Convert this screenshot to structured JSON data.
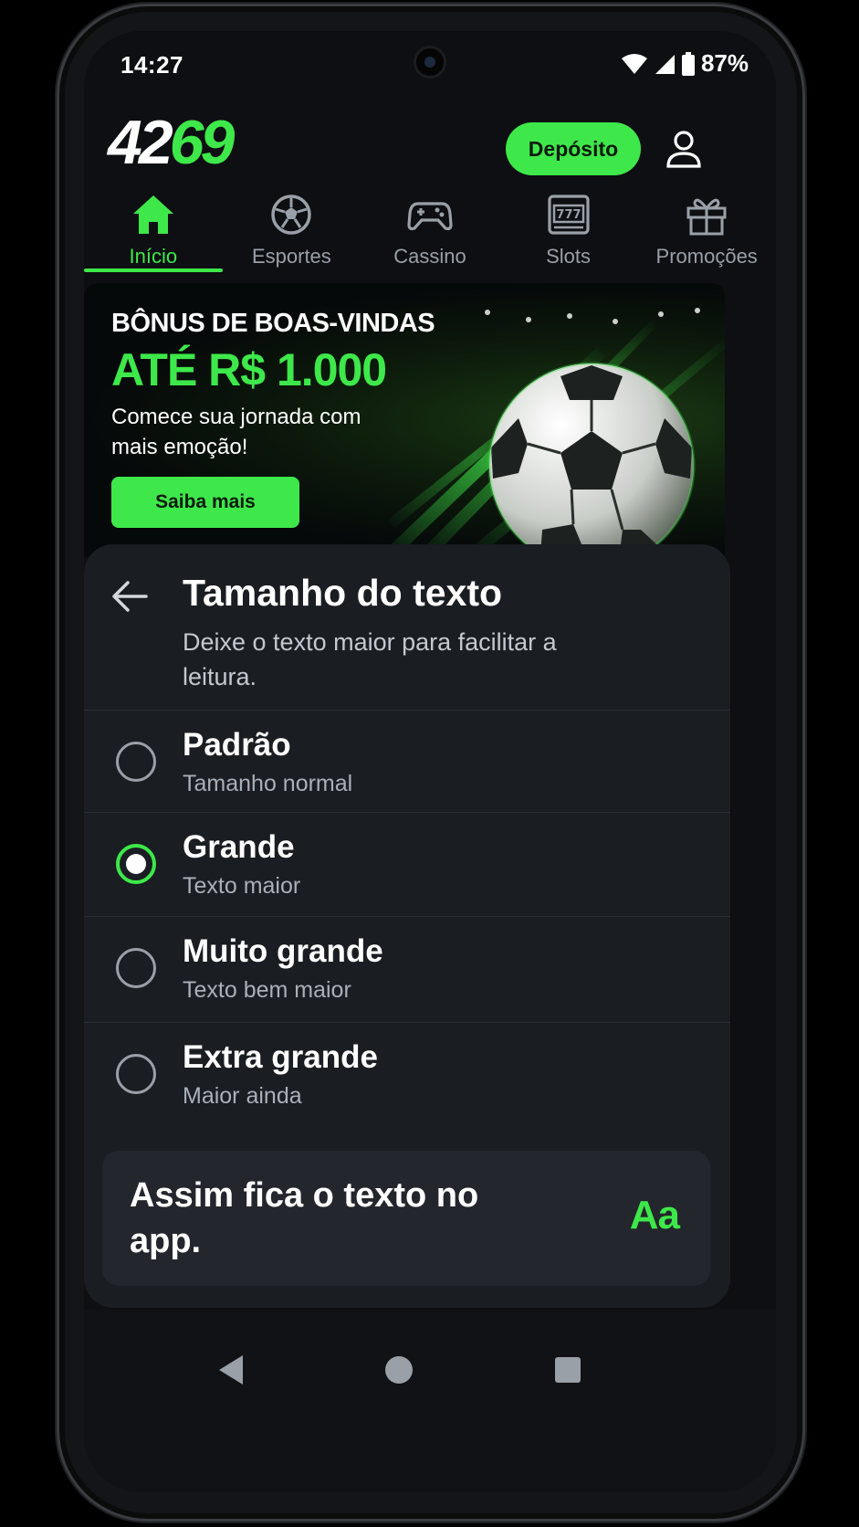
{
  "status_bar": {
    "time": "14:27",
    "battery": "87%"
  },
  "header": {
    "logo": {
      "white_part": "42",
      "green_part": "69"
    },
    "deposit_label": "Depósito"
  },
  "nav": {
    "items": [
      {
        "label": "Início",
        "icon": "home-icon",
        "active": true
      },
      {
        "label": "Esportes",
        "icon": "soccer-ball-icon",
        "active": false
      },
      {
        "label": "Cassino",
        "icon": "gamepad-icon",
        "active": false
      },
      {
        "label": "Slots",
        "icon": "slot-machine-icon",
        "active": false
      },
      {
        "label": "Promoções",
        "icon": "gift-icon",
        "active": false
      }
    ]
  },
  "banner": {
    "title": "BÔNUS DE BOAS-VINDAS",
    "amount": "ATÉ R$ 1.000",
    "subtitle": "Comece sua jornada com mais emoção!",
    "button_label": "Saiba mais"
  },
  "text_size_sheet": {
    "title": "Tamanho do texto",
    "description": "Deixe o texto maior para facilitar a leitura.",
    "options": [
      {
        "label": "Padrão",
        "sublabel": "Tamanho normal",
        "selected": false
      },
      {
        "label": "Grande",
        "sublabel": "Texto maior",
        "selected": true
      },
      {
        "label": "Muito grande",
        "sublabel": "Texto bem maior",
        "selected": false
      },
      {
        "label": "Extra grande",
        "sublabel": "Maior ainda",
        "selected": false
      }
    ],
    "preview_text": "Assim fica o texto no app.",
    "preview_glyph": "Aa"
  },
  "colors": {
    "accent": "#3ee84a",
    "background": "#0d0f12",
    "sheet": "#1a1d22"
  }
}
